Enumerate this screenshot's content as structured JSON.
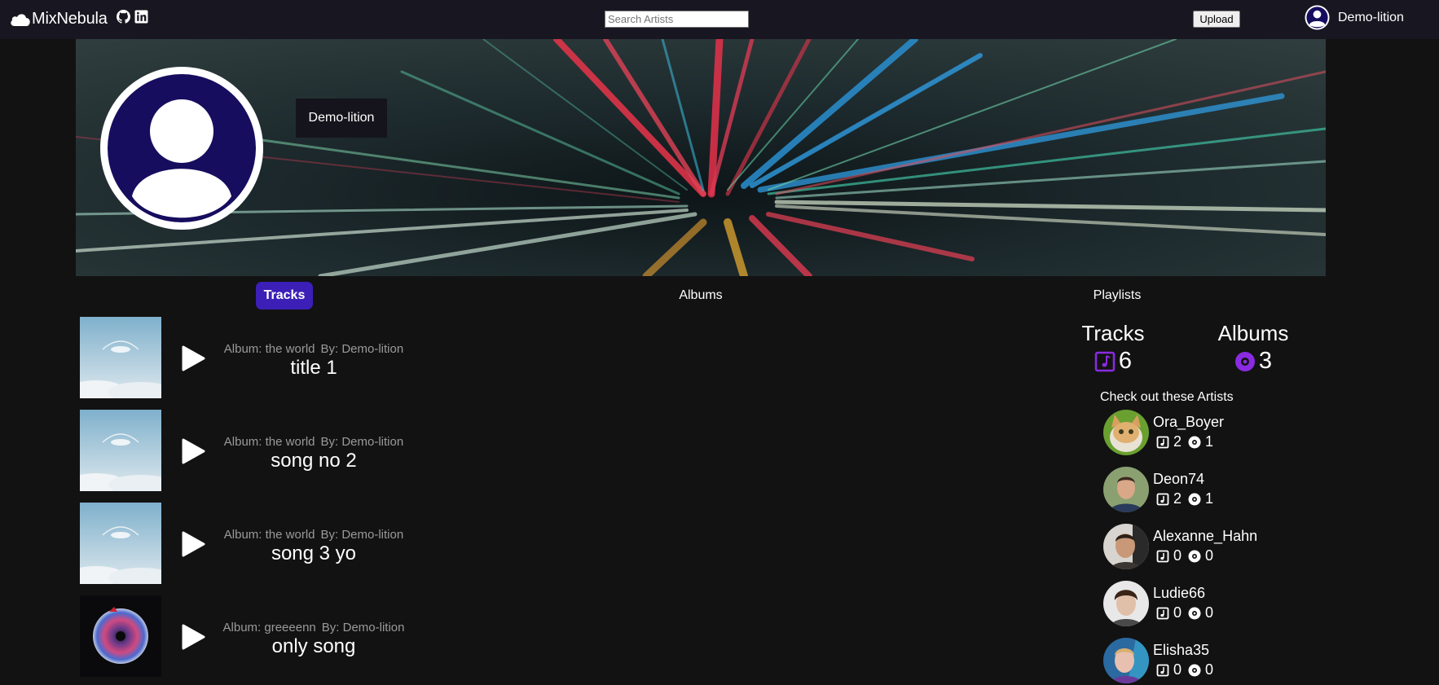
{
  "app": {
    "name": "MixNebula"
  },
  "header": {
    "search_placeholder": "Search Artists",
    "upload_label": "Upload",
    "username": "Demo-lition",
    "social_icons": [
      "github-icon",
      "linkedin-icon"
    ]
  },
  "profile": {
    "name": "Demo-lition"
  },
  "tabs": [
    {
      "label": "Tracks",
      "active": true
    },
    {
      "label": "Albums",
      "active": false
    },
    {
      "label": "Playlists",
      "active": false
    }
  ],
  "tracks": [
    {
      "album": "Album: the world",
      "by": "By: Demo-lition",
      "title": "title 1",
      "art": "clouds"
    },
    {
      "album": "Album: the world",
      "by": "By: Demo-lition",
      "title": "song no 2",
      "art": "clouds"
    },
    {
      "album": "Album: the world",
      "by": "By: Demo-lition",
      "title": "song 3 yo",
      "art": "clouds"
    },
    {
      "album": "Album: greeeenn",
      "by": "By: Demo-lition",
      "title": "only song",
      "art": "disc"
    }
  ],
  "stats": {
    "tracks_label": "Tracks",
    "tracks_count": "6",
    "albums_label": "Albums",
    "albums_count": "3"
  },
  "check_out_heading": "Check out these Artists",
  "artists": [
    {
      "name": "Ora_Boyer",
      "tracks": "2",
      "albums": "1"
    },
    {
      "name": "Deon74",
      "tracks": "2",
      "albums": "1"
    },
    {
      "name": "Alexanne_Hahn",
      "tracks": "0",
      "albums": "0"
    },
    {
      "name": "Ludie66",
      "tracks": "0",
      "albums": "0"
    },
    {
      "name": "Elisha35",
      "tracks": "0",
      "albums": "0"
    }
  ],
  "colors": {
    "accent": "#3c1fb6",
    "stat_icon": "#8a2be2",
    "topbar": "#181721",
    "background": "#121212"
  }
}
